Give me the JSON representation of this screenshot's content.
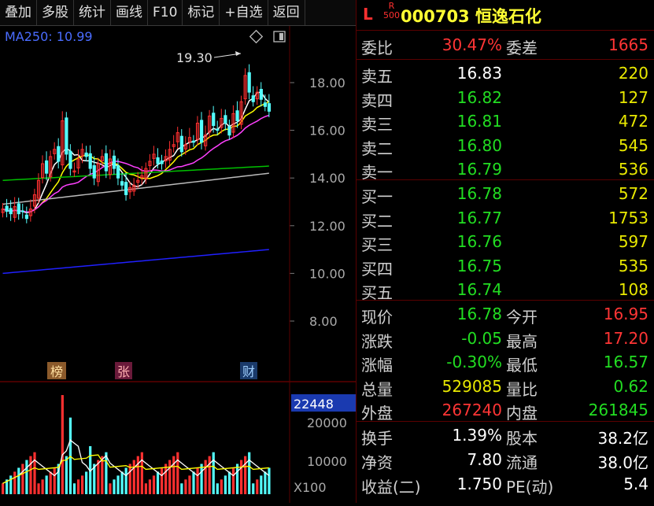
{
  "toolbar": [
    "叠加",
    "多股",
    "统计",
    "画线",
    "F10",
    "标记",
    "+自选",
    "返回"
  ],
  "chart": {
    "ma_label": "MA250: 10.99",
    "peak_label": "19.30",
    "y_ticks": [
      "18.00",
      "16.00",
      "14.00",
      "12.00",
      "10.00",
      "8.00"
    ],
    "markers": [
      "榜",
      "张",
      "财"
    ],
    "vol_value": "22448",
    "vol_ticks": [
      "20000",
      "10000"
    ],
    "vol_unit": "X100",
    "colors": {
      "up": "#ff3030",
      "down": "#54ffff",
      "ma5": "#ffffff",
      "ma10": "#ffff00",
      "ma20": "#ff40ff",
      "ma60": "#00c000",
      "ma120": "#bbbbbb",
      "ma250": "#2020ff"
    }
  },
  "quote": {
    "market_tag": "L",
    "r_tag": "R",
    "r_sub": "500",
    "code": "000703",
    "name": "恒逸石化",
    "weibi_label": "委比",
    "weibi": "30.47%",
    "weicha_label": "委差",
    "weicha": "1665",
    "asks": [
      {
        "label": "卖五",
        "price": "16.83",
        "vol": "220"
      },
      {
        "label": "卖四",
        "price": "16.82",
        "vol": "127"
      },
      {
        "label": "卖三",
        "price": "16.81",
        "vol": "472"
      },
      {
        "label": "卖二",
        "price": "16.80",
        "vol": "545"
      },
      {
        "label": "卖一",
        "price": "16.79",
        "vol": "536"
      }
    ],
    "bids": [
      {
        "label": "买一",
        "price": "16.78",
        "vol": "572"
      },
      {
        "label": "买二",
        "price": "16.77",
        "vol": "1753"
      },
      {
        "label": "买三",
        "price": "16.76",
        "vol": "597"
      },
      {
        "label": "买四",
        "price": "16.75",
        "vol": "535"
      },
      {
        "label": "买五",
        "price": "16.74",
        "vol": "108"
      }
    ],
    "stats": [
      {
        "l1": "现价",
        "v1": "16.78",
        "c1": "green",
        "l2": "今开",
        "v2": "16.95",
        "c2": "red"
      },
      {
        "l1": "涨跌",
        "v1": "-0.05",
        "c1": "green",
        "l2": "最高",
        "v2": "17.20",
        "c2": "red"
      },
      {
        "l1": "涨幅",
        "v1": "-0.30%",
        "c1": "green",
        "l2": "最低",
        "v2": "16.57",
        "c2": "green"
      },
      {
        "l1": "总量",
        "v1": "529085",
        "c1": "yellow",
        "l2": "量比",
        "v2": "0.62",
        "c2": "green"
      },
      {
        "l1": "外盘",
        "v1": "267240",
        "c1": "red",
        "l2": "内盘",
        "v2": "261845",
        "c2": "green"
      }
    ],
    "fund": [
      {
        "l1": "换手",
        "v1": "1.39%",
        "l2": "股本",
        "v2": "38.2亿"
      },
      {
        "l1": "净资",
        "v1": "7.80",
        "l2": "流通",
        "v2": "38.0亿"
      },
      {
        "l1": "收益(二)",
        "v1": "1.750",
        "l2": "PE(动)",
        "v2": "5.4"
      }
    ]
  }
}
